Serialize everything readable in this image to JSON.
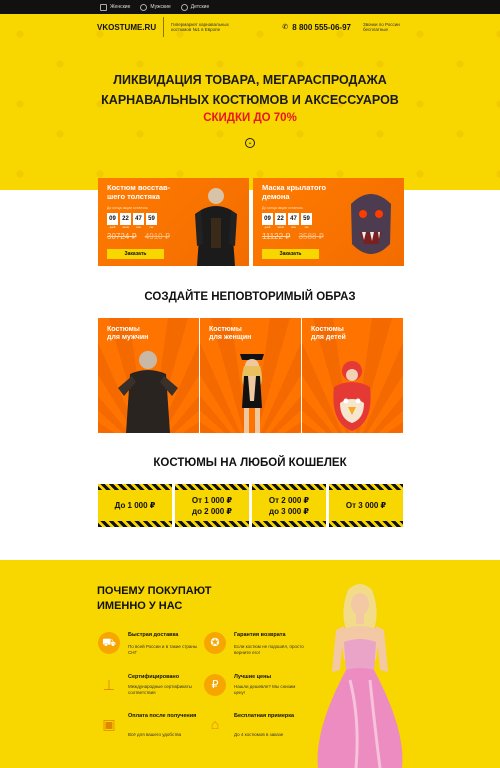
{
  "topnav": {
    "tabs": [
      {
        "label": "Женские",
        "icon": "home-icon"
      },
      {
        "label": "Мужские",
        "icon": "male-icon"
      },
      {
        "label": "Детские",
        "icon": "child-icon"
      }
    ]
  },
  "header": {
    "logo": "VKOSTUME.RU",
    "tagline": "Гипермаркет карнавальных костюмов №1 в Европе",
    "phone": "8 800 555-06-97",
    "call_info": "Звонки по России бесплатные"
  },
  "hero": {
    "title_line1": "ЛИКВИДАЦИЯ ТОВАРА, МЕГАРАСПРОДАЖА",
    "title_line2": "КАРНАВАЛЬНЫХ КОСТЮМОВ И АКСЕССУАРОВ",
    "sale": "СКИДКИ ДО 70%",
    "scroll_icon": "chevron-down-icon"
  },
  "products": [
    {
      "name": "Костюм восстав-шего толстяка",
      "until_label": "До конца акции осталось",
      "timer": [
        "09",
        "22",
        "47",
        "59"
      ],
      "timer_labels": [
        "дней",
        "часов",
        "мин",
        "сек"
      ],
      "old_price": "30724 ₽",
      "new_price": "4910 ₽",
      "button": "Заказать"
    },
    {
      "name": "Маска крылатого демона",
      "until_label": "До конца акции осталось",
      "timer": [
        "09",
        "22",
        "47",
        "59"
      ],
      "timer_labels": [
        "дней",
        "часов",
        "мин",
        "сек"
      ],
      "old_price": "11122 ₽",
      "new_price": "3588 ₽",
      "button": "Заказать"
    }
  ],
  "create": {
    "title": "СОЗДАЙТЕ НЕПОВТОРИМЫЙ ОБРАЗ",
    "categories": [
      {
        "line1": "Костюмы",
        "line2": "для мужчин"
      },
      {
        "line1": "Костюмы",
        "line2": "для женщин"
      },
      {
        "line1": "Костюмы",
        "line2": "для детей"
      }
    ]
  },
  "wallet": {
    "title": "КОСТЮМЫ НА ЛЮБОЙ КОШЕЛЕК",
    "bands": [
      {
        "line1": "До 1 000 ₽",
        "line2": ""
      },
      {
        "line1": "От 1 000 ₽",
        "line2": "до 2 000 ₽"
      },
      {
        "line1": "От 2 000 ₽",
        "line2": "до 3 000 ₽"
      },
      {
        "line1": "От 3 000 ₽",
        "line2": ""
      }
    ]
  },
  "why": {
    "title_line1": "ПОЧЕМУ ПОКУПАЮТ",
    "title_line2": "ИМЕННО У НАС",
    "features": [
      {
        "title": "Быстрая доставка",
        "desc": "По всей России и в такие страны СНГ",
        "icon": "truck-icon"
      },
      {
        "title": "Гарантия возврата",
        "desc": "Если костюм не подошёл, просто верните его!",
        "icon": "medal-icon"
      },
      {
        "title": "Сертифицировано",
        "desc": "Международные сертификаты соответствия",
        "icon": "stamp-icon"
      },
      {
        "title": "Лучшие цены",
        "desc": "Нашли дешевле? Мы снизим цену!",
        "icon": "ruble-icon"
      },
      {
        "title": "Оплата после получения",
        "desc": "Всё для вашего удобства",
        "icon": "box-icon"
      },
      {
        "title": "Бесплатная примерка",
        "desc": "До 4 костюмов в заказе",
        "icon": "hanger-icon"
      }
    ]
  },
  "colors": {
    "brand_yellow": "#f8d600",
    "accent_orange": "#ff7b00",
    "sale_red": "#e8161e"
  }
}
